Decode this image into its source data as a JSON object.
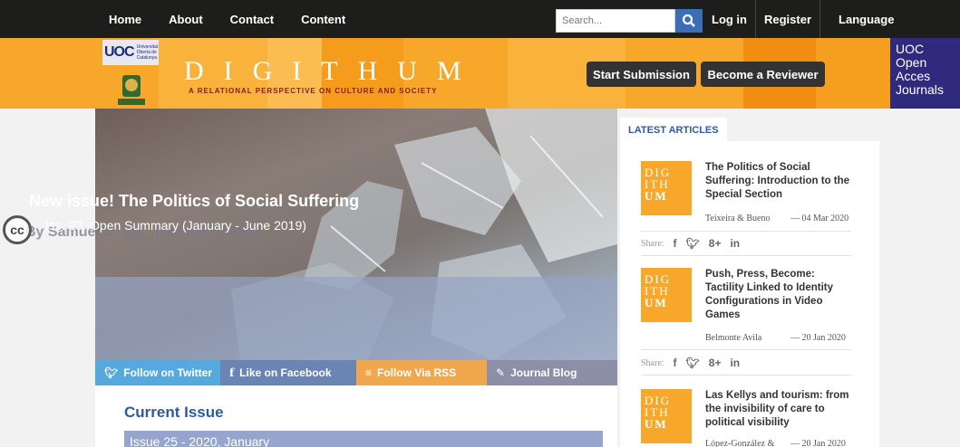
{
  "nav": {
    "items": [
      "Home",
      "About",
      "Contact",
      "Content"
    ],
    "search_placeholder": "Search...",
    "login": "Log in",
    "register": "Register",
    "language": "Language"
  },
  "header": {
    "uoc_logo": "UOC",
    "uoc_logo_small": "Universitat Oberta de Catalunya",
    "udea_logo_text": "UNIVERSIDAD DE ANTIOQUIA",
    "brand": "DIGITHUM",
    "tagline": "A RELATIONAL PERSPECTIVE ON CULTURE AND SOCIETY",
    "start_submission": "Start Submission",
    "become_reviewer": "Become a Reviewer",
    "uoc_journals": "UOC Open Acces Journals"
  },
  "hero": {
    "title": "New issue! The Politics of Social Suffering",
    "subtitle": "Iss. 23. Open Summary (January - June 2019)",
    "credit": "By Samuel C_ajg_ (source: Flickr)",
    "cc": "cc"
  },
  "social": {
    "twitter": "Follow on Twitter",
    "facebook": "Like on Facebook",
    "rss": "Follow Via RSS",
    "blog": "Journal Blog"
  },
  "main": {
    "current_issue": "Current Issue",
    "issue_bar": "Issue 25 - 2020, January"
  },
  "sidebar": {
    "tab": "LATEST ARTICLES",
    "share_label": "Share:",
    "thumb_text": [
      "DIG",
      "ITH",
      "UM"
    ],
    "articles": [
      {
        "title": "The Politics of Social Suffering: Introduction to the Special Section",
        "authors": "Teixeira & Bueno",
        "date": "04 Mar 2020"
      },
      {
        "title": "Push, Press, Become: Tactility Linked to Identity Configurations in Video Games",
        "authors": "Belmonte Avila",
        "date": "20 Jan 2020"
      },
      {
        "title": "Las Kellys and tourism: from the invisibility of care to political visibility",
        "authors": "López-González &",
        "date": "20 Jan 2020"
      }
    ]
  },
  "colors": {
    "header_orange": "#f7a82a",
    "nav_dark": "#1d1d1b",
    "accent_blue": "#2e5aa0",
    "twitter": "#56a9dd",
    "facebook": "#6a84b4",
    "rss": "#f0a74e",
    "blog": "#8d8fa6"
  }
}
